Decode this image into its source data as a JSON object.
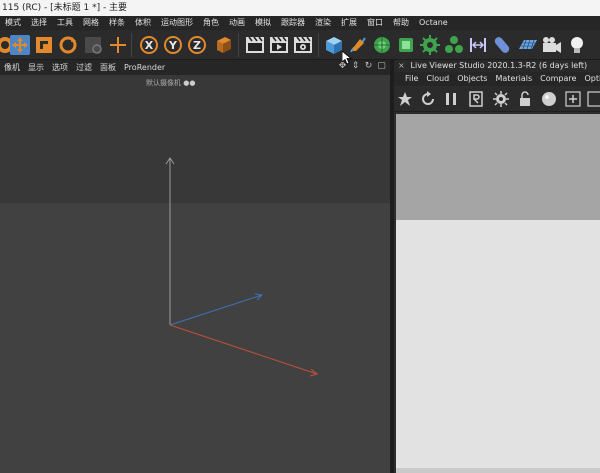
{
  "window": {
    "title": "115 (RC) - [未标题 1 *] - 主要"
  },
  "menubar": {
    "items": [
      "模式",
      "选择",
      "工具",
      "网格",
      "样条",
      "体积",
      "运动图形",
      "角色",
      "动画",
      "模拟",
      "跟踪器",
      "渲染",
      "扩展",
      "窗口",
      "帮助",
      "Octane"
    ]
  },
  "toolbar": {
    "axis_x": "X",
    "axis_y": "Y",
    "axis_z": "Z"
  },
  "viewport": {
    "menu": [
      "像机",
      "显示",
      "选项",
      "过滤",
      "面板",
      "ProRender"
    ],
    "camera_label": "默认摄像机"
  },
  "live_viewer": {
    "title": "Live Viewer Studio 2020.1.3-R2 (6 days left)",
    "menu": [
      "File",
      "Cloud",
      "Objects",
      "Materials",
      "Compare",
      "Option"
    ]
  },
  "colors": {
    "accent_orange": "#e2892c",
    "axis_x": "#c0503a",
    "axis_y": "#9a9a9a",
    "axis_z": "#3f74b8",
    "render_top": "#a5a5a5",
    "render_bottom": "#e2e2e2"
  }
}
